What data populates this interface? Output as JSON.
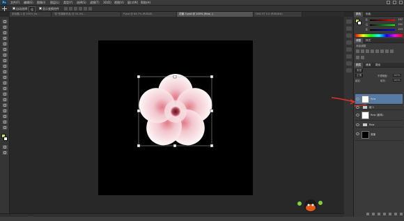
{
  "app": {
    "logo": "Ps"
  },
  "menu": [
    "文件(F)",
    "编辑(E)",
    "图像(I)",
    "图层(L)",
    "类型(Y)",
    "选择(S)",
    "滤镜(T)",
    "3D(D)",
    "视图(V)",
    "窗口(W)",
    "帮助(H)"
  ],
  "options": {
    "auto_select_label": "自动选择：",
    "auto_select_value": "组",
    "show_transform_label": "显示变换控件"
  },
  "tabs": [
    {
      "label": "未标题-1 @ 100% (lo..."
    },
    {
      "label": "\"花\"的摄影作品 @ 33.3%..."
    },
    {
      "label": "P.psd @ 66.7% (RGB/8)"
    },
    {
      "label": "花瓣-3.psd @ 100% (flow...)"
    },
    {
      "label": "DVD ST 0.5 (RGB/8#)"
    }
  ],
  "status": {
    "zoom": "66.67%",
    "doc": "文档:1.72M/5.00M"
  },
  "color_panel": {
    "tab_color": "颜色",
    "tab_swatches": "色板",
    "r_label": "R",
    "g_label": "G",
    "b_label": "B",
    "r": "237",
    "g": "222",
    "b": "223"
  },
  "adjust_panel": {
    "tab1": "调整",
    "tab2": "样式",
    "title": "添加调整"
  },
  "layers_panel": {
    "tabs": [
      "图层",
      "通道",
      "路径"
    ],
    "kind": "类型",
    "blend": "正常",
    "opacity_label": "不透明度：",
    "opacity": "100%",
    "lock_label": "锁定：",
    "fill_label": "填充：",
    "fill": "100%",
    "layers": [
      {
        "type": "layer",
        "name": "flow",
        "selected": true
      },
      {
        "type": "group",
        "name": "组 1"
      },
      {
        "type": "layer",
        "name": "flow (副本)",
        "selected": false
      },
      {
        "type": "group",
        "name": "flow"
      },
      {
        "type": "layer",
        "name": "背景",
        "selected": false,
        "black": true
      }
    ]
  },
  "colors": {
    "accent": "#587ba5",
    "arrow": "#e0302a"
  }
}
